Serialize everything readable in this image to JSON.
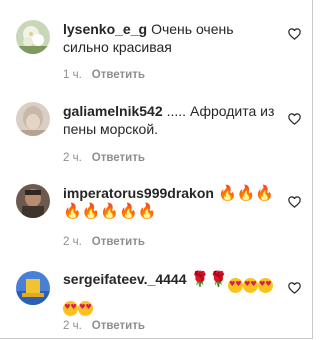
{
  "comments": [
    {
      "username": "lysenko_e_g",
      "text": "Очень очень сильно красивая",
      "time": "1 ч.",
      "reply_label": "Ответить"
    },
    {
      "username": "galiamelnik542",
      "text": "..... Афродита из пены морской.",
      "time": "2 ч.",
      "reply_label": "Ответить"
    },
    {
      "username": "imperatorus999drakon",
      "text": "",
      "time": "2 ч.",
      "reply_label": "Ответить",
      "emojis": [
        "fire",
        "fire",
        "fire",
        "fire",
        "fire",
        "fire",
        "fire",
        "fire"
      ]
    },
    {
      "username": "sergeifateev._4444",
      "text": "",
      "time": "2 ч.",
      "reply_label": "Ответить",
      "emojis": [
        "rose",
        "rose",
        "heart-eyes",
        "heart-eyes",
        "heart-eyes",
        "heart-eyes",
        "heart-eyes"
      ]
    }
  ],
  "icons": {
    "like": "heart-outline-icon"
  },
  "colors": {
    "text": "#262626",
    "meta": "#8e8e8e"
  }
}
